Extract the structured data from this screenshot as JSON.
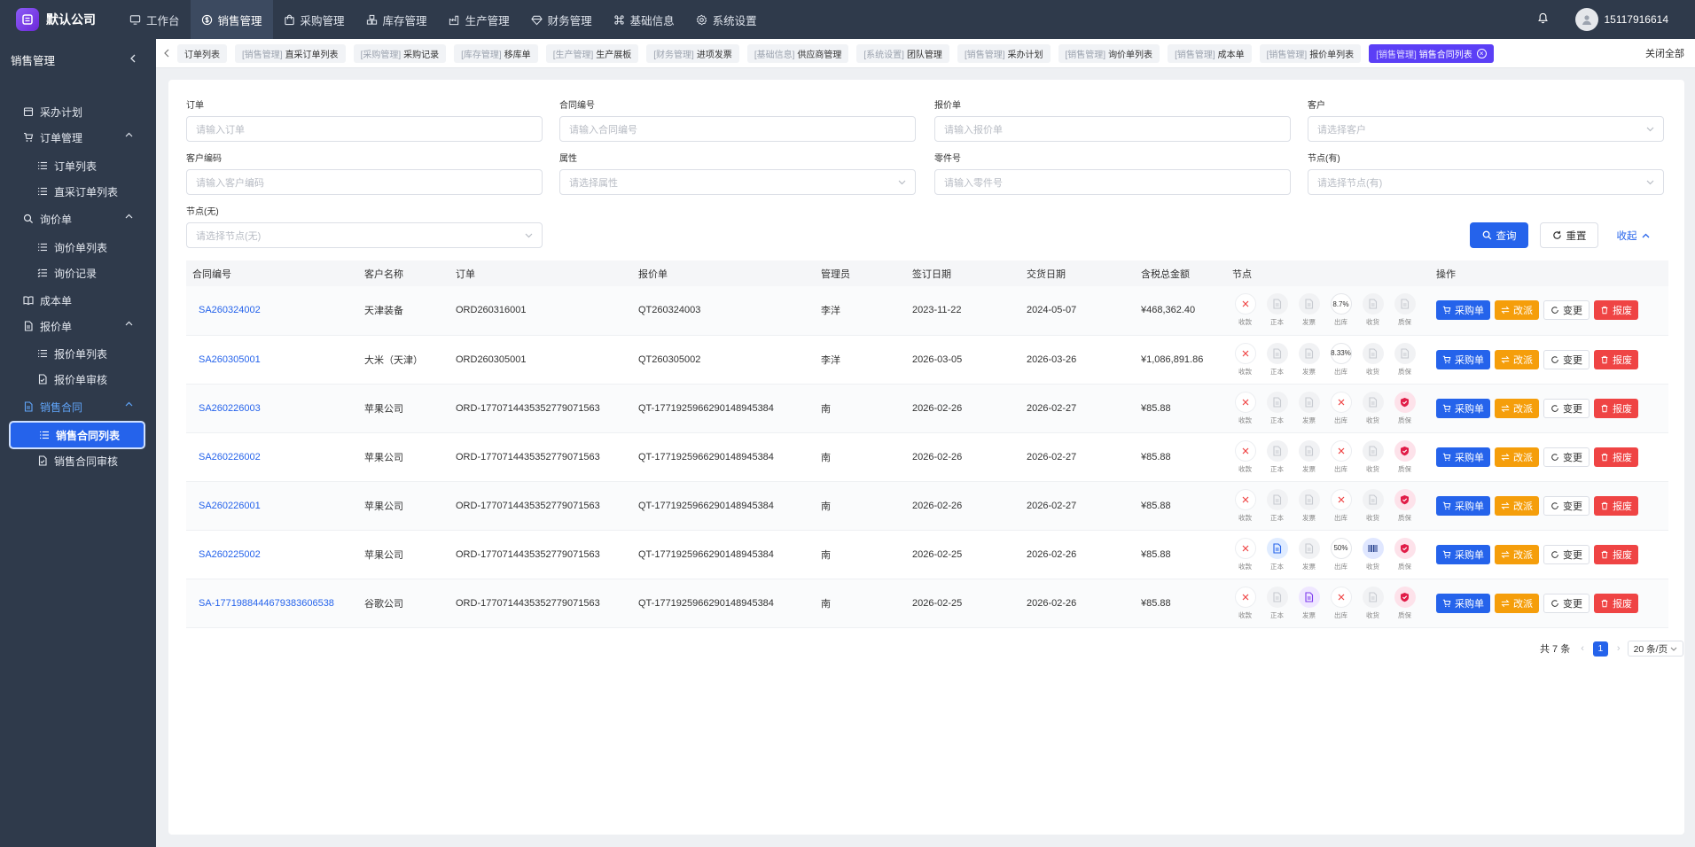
{
  "app": {
    "company": "默认公司",
    "user_phone": "15117916614"
  },
  "topnav": [
    {
      "label": "工作台",
      "icon": "monitor-icon"
    },
    {
      "label": "销售管理",
      "icon": "dollar-icon",
      "active": true
    },
    {
      "label": "采购管理",
      "icon": "bag-icon"
    },
    {
      "label": "库存管理",
      "icon": "boxes-icon"
    },
    {
      "label": "生产管理",
      "icon": "factory-icon"
    },
    {
      "label": "财务管理",
      "icon": "diamond-icon"
    },
    {
      "label": "基础信息",
      "icon": "command-icon"
    },
    {
      "label": "系统设置",
      "icon": "gear-icon"
    }
  ],
  "sidebar": {
    "title": "销售管理",
    "items": [
      {
        "label": "采办计划",
        "level": 1,
        "icon": "calendar-icon"
      },
      {
        "label": "订单管理",
        "level": 1,
        "icon": "cart-icon",
        "expandable": true
      },
      {
        "label": "订单列表",
        "level": 2,
        "icon": "list-icon"
      },
      {
        "label": "直采订单列表",
        "level": 2,
        "icon": "list-icon"
      },
      {
        "label": "询价单",
        "level": 1,
        "icon": "search-icon",
        "expandable": true
      },
      {
        "label": "询价单列表",
        "level": 2,
        "icon": "list-icon"
      },
      {
        "label": "询价记录",
        "level": 2,
        "icon": "list-check-icon"
      },
      {
        "label": "成本单",
        "level": 1,
        "icon": "book-icon"
      },
      {
        "label": "报价单",
        "level": 1,
        "icon": "document-icon",
        "expandable": true
      },
      {
        "label": "报价单列表",
        "level": 2,
        "icon": "list-icon"
      },
      {
        "label": "报价单审核",
        "level": 2,
        "icon": "file-check-icon"
      },
      {
        "label": "销售合同",
        "level": 1,
        "icon": "document-icon",
        "expandable": true,
        "open": true
      },
      {
        "label": "销售合同列表",
        "level": 2,
        "icon": "list-icon",
        "selected": true
      },
      {
        "label": "销售合同审核",
        "level": 2,
        "icon": "file-check-icon"
      }
    ]
  },
  "tabs": [
    {
      "prefix": "",
      "label": "订单列表"
    },
    {
      "prefix": "[销售管理]",
      "label": "直采订单列表"
    },
    {
      "prefix": "[采购管理]",
      "label": "采购记录"
    },
    {
      "prefix": "[库存管理]",
      "label": "移库单"
    },
    {
      "prefix": "[生产管理]",
      "label": "生产展板"
    },
    {
      "prefix": "[财务管理]",
      "label": "进项发票"
    },
    {
      "prefix": "[基础信息]",
      "label": "供应商管理"
    },
    {
      "prefix": "[系统设置]",
      "label": "团队管理"
    },
    {
      "prefix": "[销售管理]",
      "label": "采办计划"
    },
    {
      "prefix": "[销售管理]",
      "label": "询价单列表"
    },
    {
      "prefix": "[销售管理]",
      "label": "成本单"
    },
    {
      "prefix": "[销售管理]",
      "label": "报价单列表"
    },
    {
      "prefix": "[销售管理]",
      "label": "销售合同列表",
      "active": true
    }
  ],
  "close_all": "关闭全部",
  "filters": [
    {
      "label": "订单",
      "placeholder": "请输入订单",
      "type": "input"
    },
    {
      "label": "合同编号",
      "placeholder": "请输入合同编号",
      "type": "input"
    },
    {
      "label": "报价单",
      "placeholder": "请输入报价单",
      "type": "input"
    },
    {
      "label": "客户",
      "placeholder": "请选择客户",
      "type": "select"
    },
    {
      "label": "客户编码",
      "placeholder": "请输入客户编码",
      "type": "input"
    },
    {
      "label": "属性",
      "placeholder": "请选择属性",
      "type": "select"
    },
    {
      "label": "零件号",
      "placeholder": "请输入零件号",
      "type": "input"
    },
    {
      "label": "节点(有)",
      "placeholder": "请选择节点(有)",
      "type": "select"
    },
    {
      "label": "节点(无)",
      "placeholder": "请选择节点(无)",
      "type": "select"
    }
  ],
  "actions": {
    "search": "查询",
    "reset": "重置",
    "collapse": "收起"
  },
  "table": {
    "columns": [
      "合同编号",
      "客户名称",
      "订单",
      "报价单",
      "管理员",
      "签订日期",
      "交货日期",
      "含税总金额",
      "节点",
      "操作"
    ],
    "node_labels": [
      "收款",
      "正本",
      "发票",
      "出库",
      "收货",
      "质保"
    ],
    "row_actions": [
      "采购单",
      "改派",
      "变更",
      "报废"
    ],
    "rows": [
      {
        "contract": "SA260324002",
        "customer": "天津装备",
        "order": "ORD260316001",
        "quote": "QT260324003",
        "manager": "李洋",
        "sign_date": "2023-11-22",
        "delivery_date": "2024-05-07",
        "amount": "¥468,362.40",
        "nodes": [
          "x",
          "grey",
          "grey",
          "8.7%",
          "grey",
          "grey"
        ]
      },
      {
        "contract": "SA260305001",
        "customer": "大米（天津）",
        "order": "ORD260305001",
        "quote": "QT260305002",
        "manager": "李洋",
        "sign_date": "2026-03-05",
        "delivery_date": "2026-03-26",
        "amount": "¥1,086,891.86",
        "nodes": [
          "x",
          "grey",
          "grey",
          "8.33%",
          "grey",
          "grey"
        ]
      },
      {
        "contract": "SA260226003",
        "customer": "苹果公司",
        "order": "ORD-1770714435352779071563",
        "quote": "QT-1771925966290148945384",
        "manager": "南",
        "sign_date": "2026-02-26",
        "delivery_date": "2026-02-27",
        "amount": "¥85.88",
        "nodes": [
          "x",
          "grey",
          "grey",
          "x",
          "grey",
          "pink"
        ]
      },
      {
        "contract": "SA260226002",
        "customer": "苹果公司",
        "order": "ORD-1770714435352779071563",
        "quote": "QT-1771925966290148945384",
        "manager": "南",
        "sign_date": "2026-02-26",
        "delivery_date": "2026-02-27",
        "amount": "¥85.88",
        "nodes": [
          "x",
          "grey",
          "grey",
          "x",
          "grey",
          "pink"
        ]
      },
      {
        "contract": "SA260226001",
        "customer": "苹果公司",
        "order": "ORD-1770714435352779071563",
        "quote": "QT-1771925966290148945384",
        "manager": "南",
        "sign_date": "2026-02-26",
        "delivery_date": "2026-02-27",
        "amount": "¥85.88",
        "nodes": [
          "x",
          "grey",
          "grey",
          "x",
          "grey",
          "pink"
        ]
      },
      {
        "contract": "SA260225002",
        "customer": "苹果公司",
        "order": "ORD-1770714435352779071563",
        "quote": "QT-1771925966290148945384",
        "manager": "南",
        "sign_date": "2026-02-25",
        "delivery_date": "2026-02-26",
        "amount": "¥85.88",
        "nodes": [
          "x",
          "blue",
          "grey",
          "50%",
          "barcode",
          "pink"
        ]
      },
      {
        "contract": "SA-1771988444679383606538",
        "customer": "谷歌公司",
        "order": "ORD-1770714435352779071563",
        "quote": "QT-1771925966290148945384",
        "manager": "南",
        "sign_date": "2026-02-25",
        "delivery_date": "2026-02-26",
        "amount": "¥85.88",
        "nodes": [
          "x",
          "grey",
          "purple",
          "x",
          "grey",
          "pink"
        ]
      }
    ]
  },
  "pagination": {
    "total": "共 7 条",
    "page": "1",
    "page_size": "20 条/页"
  }
}
